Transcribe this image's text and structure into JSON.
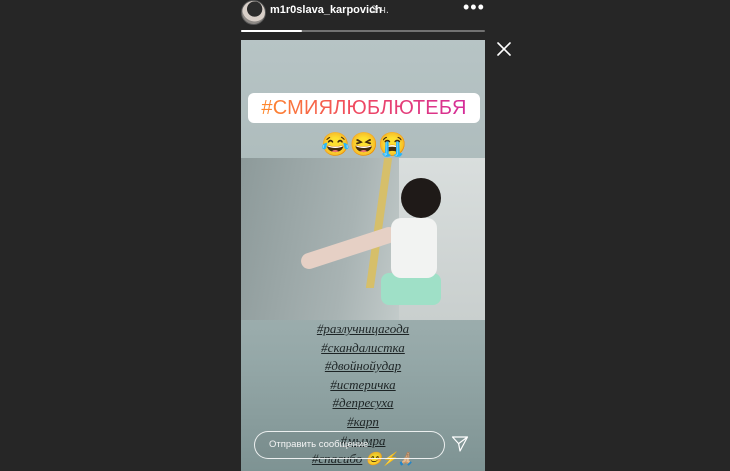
{
  "header": {
    "username": "m1r0slava_karpovich",
    "time": "3 ч.",
    "progress": 0.25
  },
  "story": {
    "hashtag_sticker": "#СМИЯЛЮБЛЮТЕБЯ",
    "emojis": "😂😆😭",
    "tags": [
      "#разлучницагода",
      "#скандалистка",
      "#двойнойудар",
      "#истеричка",
      "#депресуха",
      "#карп",
      "#мымра"
    ],
    "last_tag": "#спасибо",
    "last_tag_emojis": "😊⚡🙏🏼"
  },
  "footer": {
    "message_placeholder": "Отправить сообщение"
  },
  "icons": {
    "more": "more-horizontal-icon",
    "close": "close-icon",
    "send": "send-icon"
  },
  "colors": {
    "background": "#262626",
    "sticker_gradient_start": "#ff8a2b",
    "sticker_gradient_end": "#d42c9a"
  }
}
